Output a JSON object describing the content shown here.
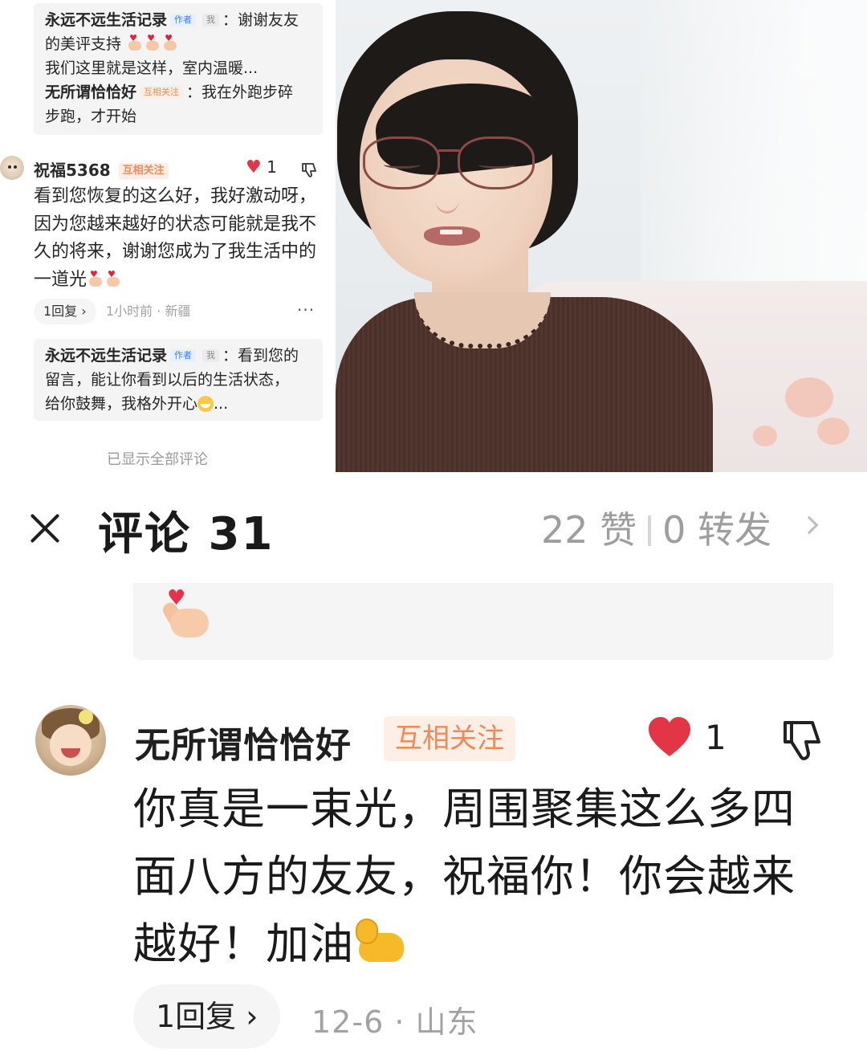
{
  "thread_preview": {
    "reply_box_1": {
      "author": "永远不远生活记录",
      "author_tag": "作者",
      "me_tag": "我",
      "text_line1": "：谢谢友友",
      "text_line2": "的美评支持",
      "text_line3": "我们这里就是这样，室内温暖...",
      "reply2_author": "无所谓恰恰好",
      "reply2_tag": "互相关注",
      "reply2_text1": "：我在外跑步碎",
      "reply2_text2": "步跑，才开始"
    },
    "comment": {
      "author": "祝福5368",
      "tag": "互相关注",
      "likes": "1",
      "text": "看到您恢复的这么好，我好激动呀，因为您越来越好的状态可能就是我不久的将来，谢谢您成为了我生活中的一道光",
      "reply_count": "1回复",
      "meta": "1小时前 · 新疆",
      "more": "···"
    },
    "reply_box_2": {
      "author": "永远不远生活记录",
      "author_tag": "作者",
      "me_tag": "我",
      "line1": "：看到您的",
      "line2": "留言，能让你看到以后的生活状态，",
      "line3": "给你鼓舞，我格外开心",
      "line3_end": "..."
    },
    "all_shown": "已显示全部评论"
  },
  "header": {
    "title": "评论 31",
    "likes": "22 赞",
    "shares": "0 转发"
  },
  "main_comment": {
    "author": "无所谓恰恰好",
    "tag": "互相关注",
    "likes": "1",
    "text": "你真是一束光，周围聚集这么多四面八方的友友，祝福你！你会越来越好！加油",
    "reply_count": "1回复",
    "meta": "12-6 · 山东"
  },
  "colors": {
    "like_heart": "#e23646",
    "mutual_tag_bg": "#fdefe6",
    "mutual_tag_text": "#ee8a57",
    "meta_gray": "#a2a2a2"
  },
  "icons": {
    "close": "close-icon",
    "heart": "heart-icon",
    "dislike": "thumbs-down-icon",
    "chevron": "chevron-right-icon",
    "finger_heart": "finger-heart-emoji",
    "muscle": "flexed-biceps-emoji"
  }
}
